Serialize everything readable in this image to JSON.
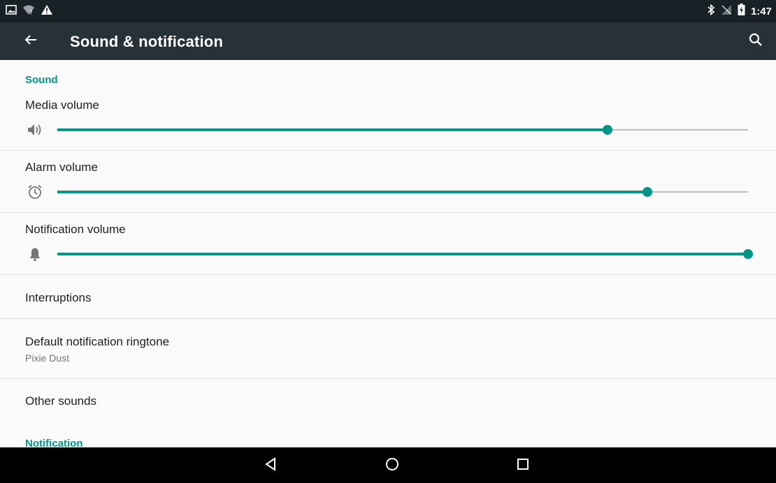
{
  "status_bar": {
    "time": "1:47",
    "left_icons": [
      "picture-notification-icon",
      "wifi-unknown-icon",
      "alert-triangle-icon"
    ],
    "right_icons": [
      "bluetooth-icon",
      "no-signal-icon",
      "battery-charging-icon"
    ]
  },
  "app_bar": {
    "title": "Sound & notification",
    "back_icon": "arrow-back-icon",
    "search_icon": "search-icon",
    "background_color": "#263238"
  },
  "accent_color": "#009688",
  "sections": {
    "sound": {
      "header": "Sound"
    },
    "notification": {
      "header": "Notification"
    }
  },
  "volumes": [
    {
      "label": "Media volume",
      "icon": "speaker-icon",
      "level": 0.797
    },
    {
      "label": "Alarm volume",
      "icon": "alarm-clock-icon",
      "level": 0.854
    },
    {
      "label": "Notification volume",
      "icon": "bell-icon",
      "level": 1.0
    }
  ],
  "preferences": {
    "interruptions": {
      "title": "Interruptions"
    },
    "ringtone": {
      "title": "Default notification ringtone",
      "summary": "Pixie Dust"
    },
    "other_sounds": {
      "title": "Other sounds"
    }
  },
  "nav_bar": {
    "back": "nav-back-icon",
    "home": "nav-home-icon",
    "recents": "nav-recents-icon"
  }
}
